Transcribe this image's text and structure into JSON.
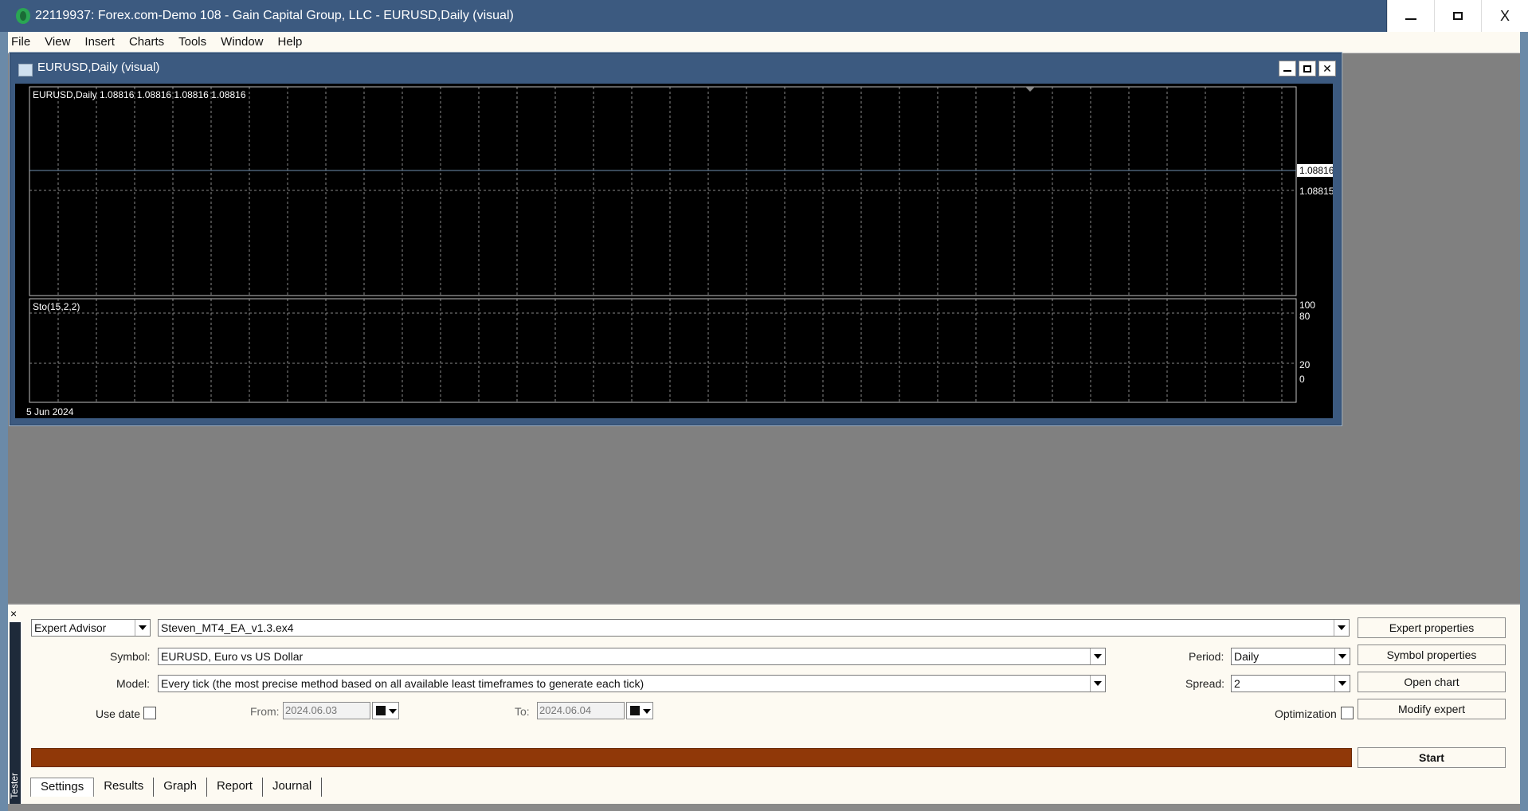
{
  "window": {
    "title": "22119937: Forex.com-Demo 108 - Gain Capital Group, LLC - EURUSD,Daily (visual)",
    "minimize": "–",
    "maximize": "□",
    "close": "X"
  },
  "menu": [
    "File",
    "View",
    "Insert",
    "Charts",
    "Tools",
    "Window",
    "Help"
  ],
  "chart_window": {
    "title": "EURUSD,Daily (visual)",
    "header_label": "EURUSD,Daily  1.08816 1.08816 1.08816 1.08816",
    "current_price": "1.08816",
    "price_ticks": [
      "1.08815"
    ],
    "indicator_label": "Sto(15,2,2)",
    "indicator_ticks": [
      "100",
      "80",
      "20",
      "0"
    ],
    "date_label": "5 Jun 2024"
  },
  "chart_data": {
    "type": "line",
    "title": "EURUSD,Daily",
    "series": [
      {
        "name": "EURUSD",
        "values": [
          1.08816
        ]
      }
    ],
    "indicator": {
      "name": "Sto(15,2,2)",
      "levels": [
        100,
        80,
        20,
        0
      ]
    },
    "xlabel": "",
    "ylabel": "",
    "grid": true
  },
  "tester": {
    "type_combo": "Expert Advisor",
    "expert_file": "Steven_MT4_EA_v1.3.ex4",
    "symbol_label": "Symbol:",
    "symbol_value": "EURUSD, Euro vs US Dollar",
    "model_label": "Model:",
    "model_value": "Every tick (the most precise method based on all available least timeframes to generate each tick)",
    "use_date_label": "Use date",
    "from_label": "From:",
    "from_value": "2024.06.03",
    "to_label": "To:",
    "to_value": "2024.06.04",
    "period_label": "Period:",
    "period_value": "Daily",
    "spread_label": "Spread:",
    "spread_value": "2",
    "optimization_label": "Optimization",
    "buttons": {
      "expert_properties": "Expert properties",
      "symbol_properties": "Symbol properties",
      "open_chart": "Open chart",
      "modify_expert": "Modify expert",
      "start": "Start"
    },
    "side_label": "Tester",
    "close": "×",
    "tabs": [
      "Settings",
      "Results",
      "Graph",
      "Report",
      "Journal"
    ]
  },
  "colors": {
    "titlebar": "#3c5a80",
    "progress": "#903808",
    "chart_bg": "#000000",
    "grid": "#8a8a8a"
  }
}
